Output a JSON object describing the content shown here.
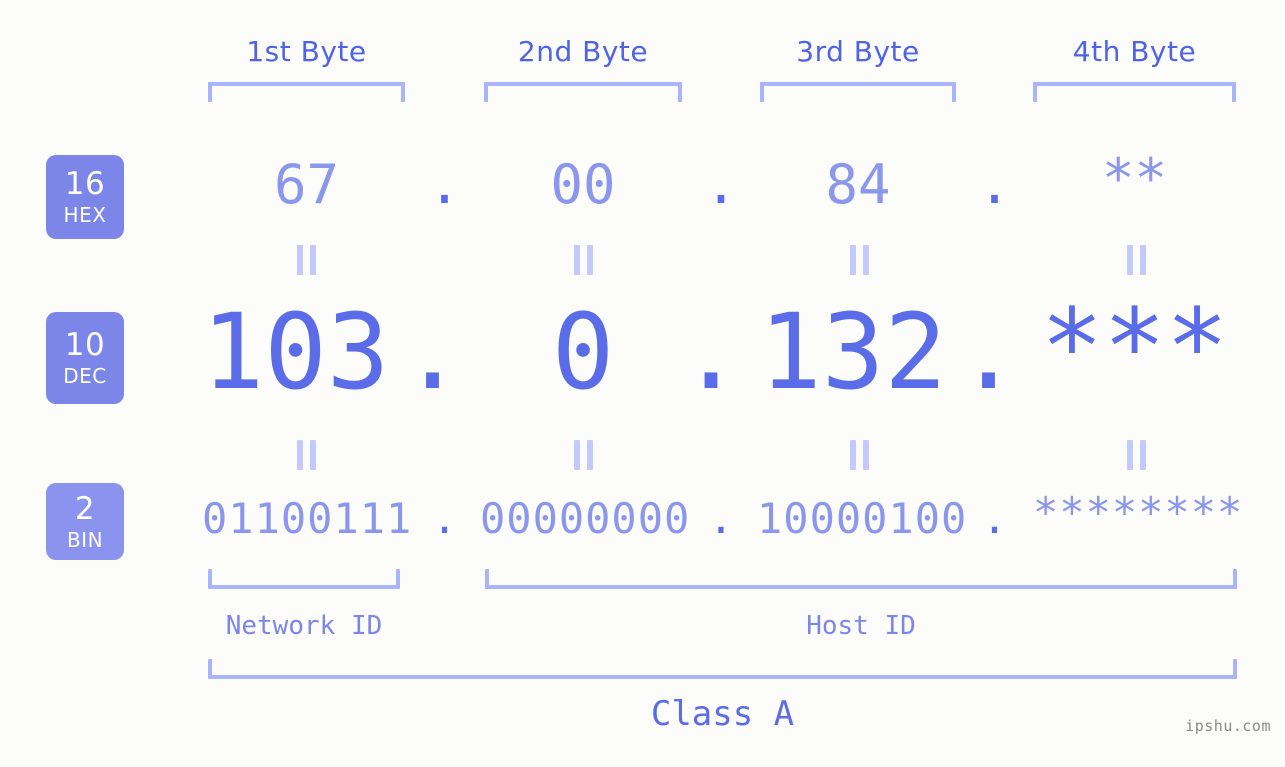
{
  "page": {
    "background": "#fcfdfa",
    "accent": "#5b6ce8",
    "accent_light": "#8b96ed",
    "bracket_color": "#aab4fb",
    "badge_color": "#7b86e8",
    "watermark": "ipshu.com"
  },
  "byte_headers": [
    {
      "label": "1st Byte"
    },
    {
      "label": "2nd Byte"
    },
    {
      "label": "3rd Byte"
    },
    {
      "label": "4th Byte"
    }
  ],
  "bases": [
    {
      "num": "16",
      "name": "HEX"
    },
    {
      "num": "10",
      "name": "DEC"
    },
    {
      "num": "2",
      "name": "BIN"
    }
  ],
  "rows": {
    "hex": {
      "base_num": "16",
      "base_name": "HEX",
      "values": [
        "67",
        "00",
        "84",
        "**"
      ],
      "separators": [
        ".",
        ".",
        "."
      ]
    },
    "dec": {
      "base_num": "10",
      "base_name": "DEC",
      "values": [
        "103",
        "0",
        "132",
        "***"
      ],
      "separators": [
        ".",
        ".",
        "."
      ]
    },
    "bin": {
      "base_num": "2",
      "base_name": "BIN",
      "values": [
        "01100111",
        "00000000",
        "10000100",
        "********"
      ],
      "separators": [
        ".",
        ".",
        "."
      ]
    }
  },
  "equals_markers": {
    "glyph": "=",
    "count_per_gap": 4
  },
  "sections": {
    "network_id": "Network ID",
    "host_id": "Host ID",
    "class": "Class A"
  }
}
